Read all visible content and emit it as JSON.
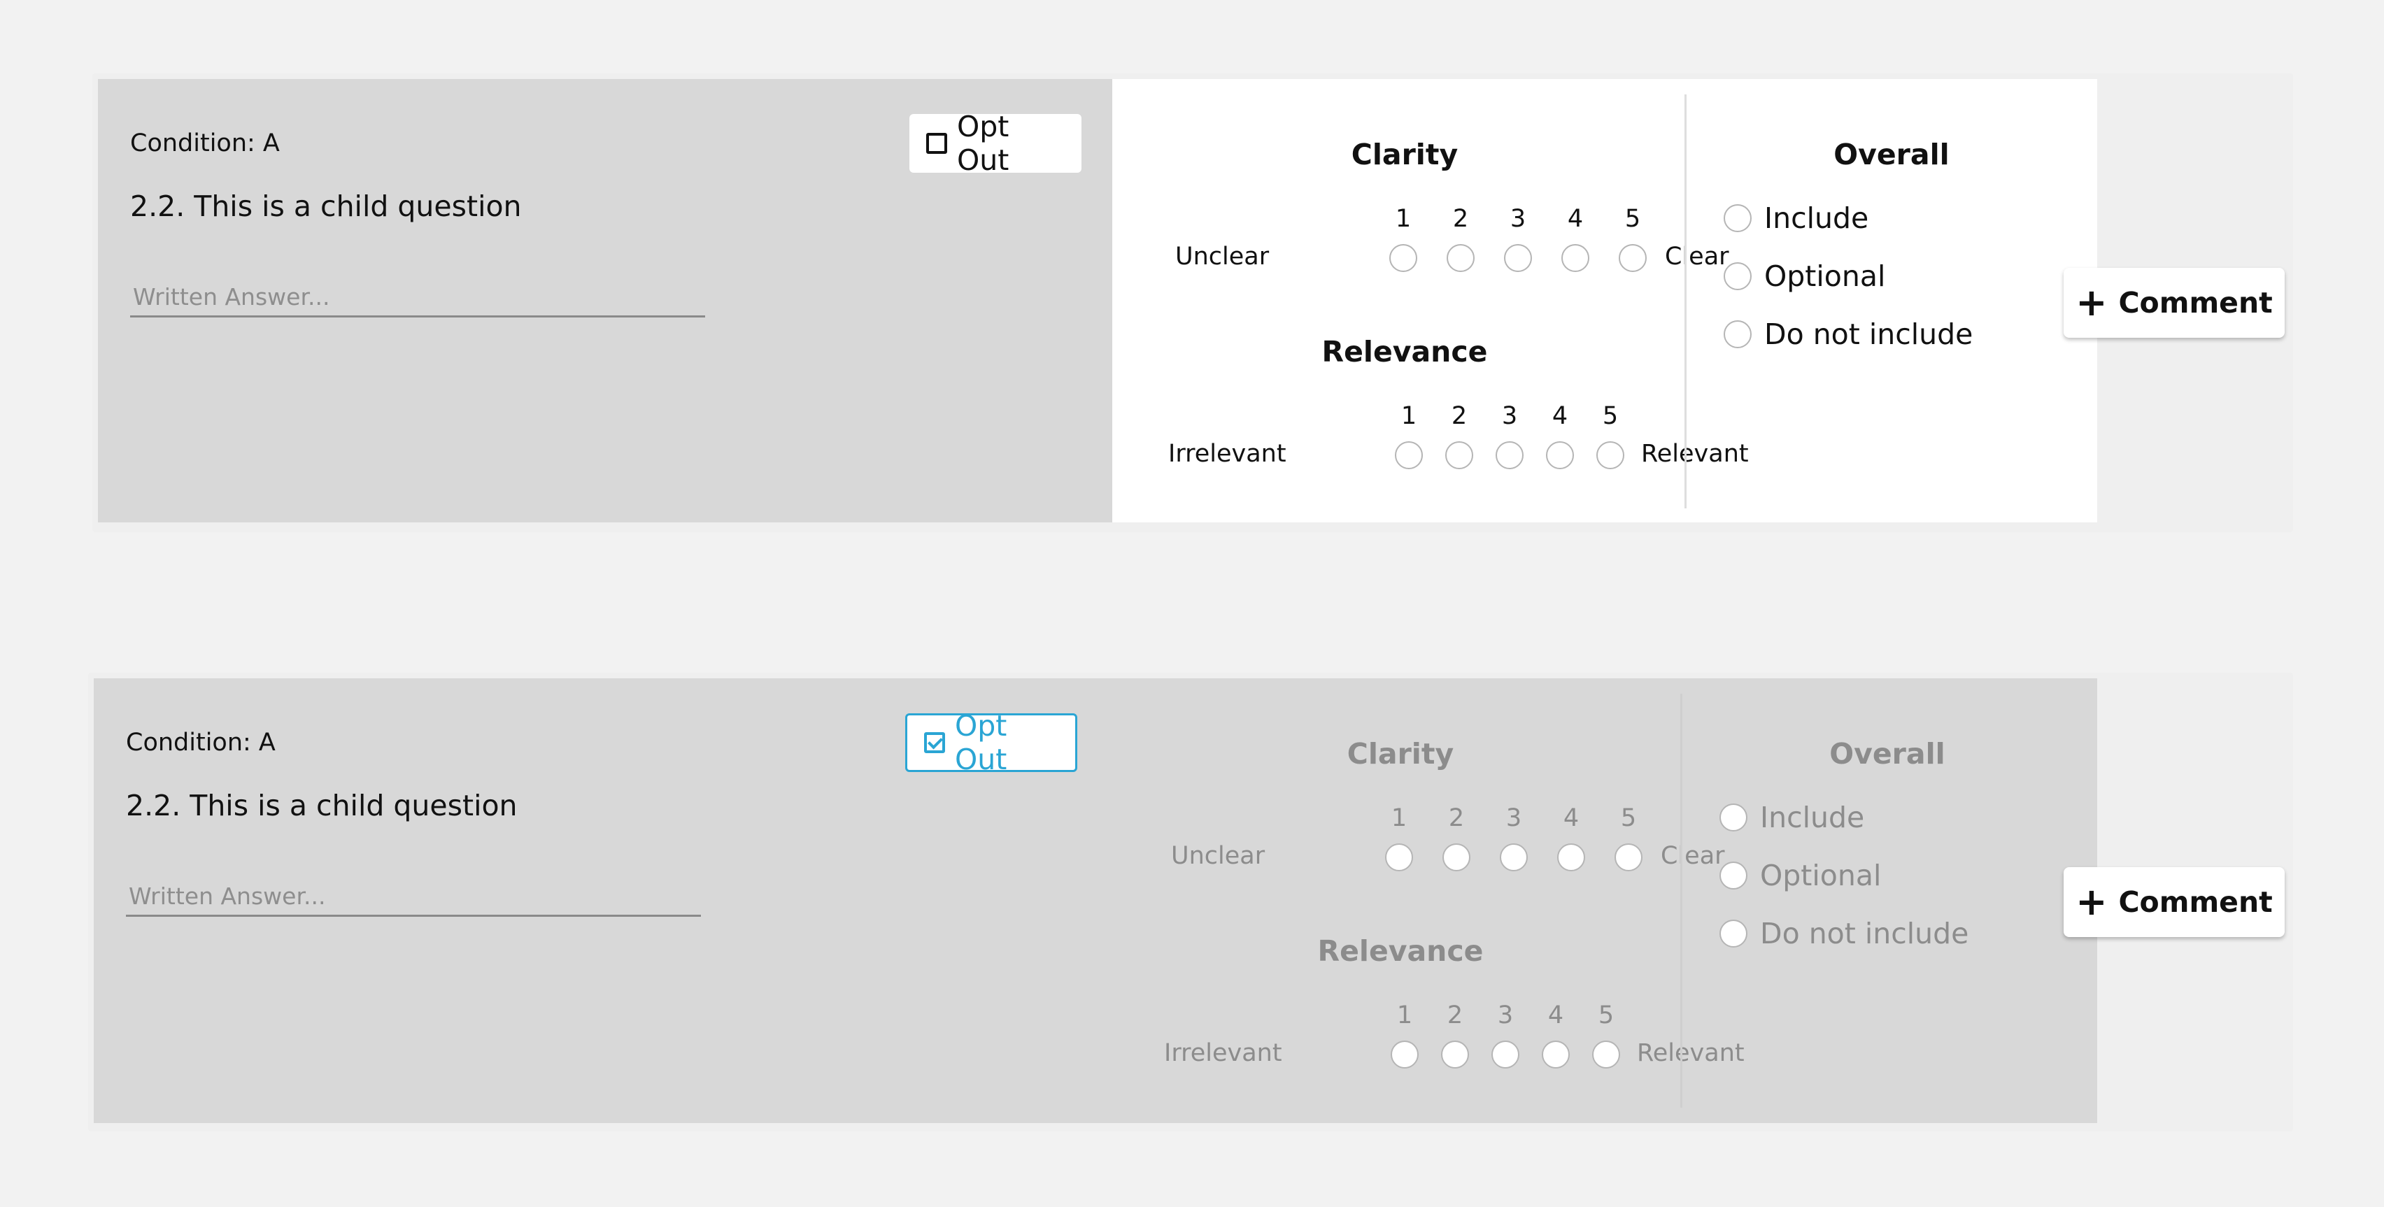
{
  "cards": [
    {
      "condition": "Condition: A",
      "question": "2.2. This is a child question",
      "answer_placeholder": "Written Answer...",
      "opt_out_label": "Opt Out",
      "opt_out_checked": false,
      "clarity": {
        "heading": "Clarity",
        "numbers": [
          "1",
          "2",
          "3",
          "4",
          "5"
        ],
        "low_label": "Unclear",
        "high_label": "Clear"
      },
      "relevance": {
        "heading": "Relevance",
        "numbers": [
          "1",
          "2",
          "3",
          "4",
          "5"
        ],
        "low_label": "Irrelevant",
        "high_label": "Relevant"
      },
      "overall": {
        "heading": "Overall",
        "options": [
          "Include",
          "Optional",
          "Do not include"
        ]
      },
      "comment_label": "Comment",
      "comment_icon": "plus-icon"
    },
    {
      "condition": "Condition: A",
      "question": "2.2. This is a child question",
      "answer_placeholder": "Written Answer...",
      "opt_out_label": "Opt Out",
      "opt_out_checked": true,
      "clarity": {
        "heading": "Clarity",
        "numbers": [
          "1",
          "2",
          "3",
          "4",
          "5"
        ],
        "low_label": "Unclear",
        "high_label": "Clear"
      },
      "relevance": {
        "heading": "Relevance",
        "numbers": [
          "1",
          "2",
          "3",
          "4",
          "5"
        ],
        "low_label": "Irrelevant",
        "high_label": "Relevant"
      },
      "overall": {
        "heading": "Overall",
        "options": [
          "Include",
          "Optional",
          "Do not include"
        ]
      },
      "comment_label": "Comment",
      "comment_icon": "plus-icon"
    }
  ],
  "colors": {
    "accent": "#2aa5d4",
    "page_background": "#f2f2f2",
    "panel_gray": "#d8d8d8",
    "disabled_text": "#8c8c8c"
  }
}
